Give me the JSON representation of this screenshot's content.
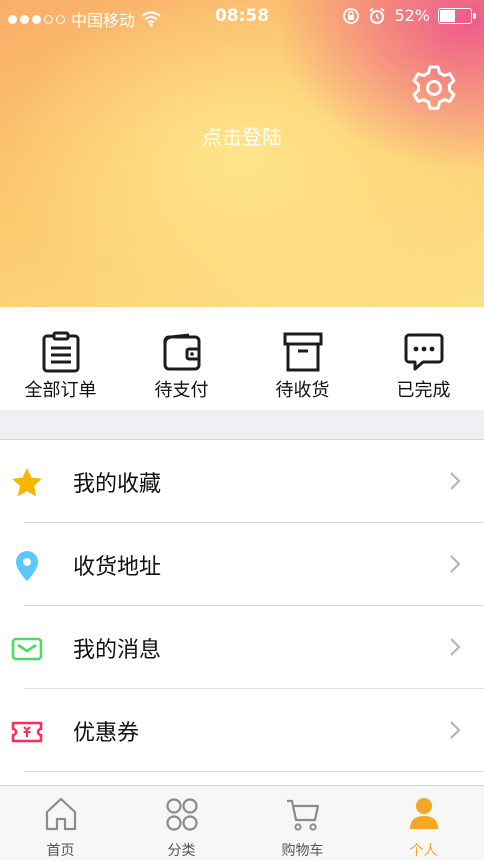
{
  "status_bar": {
    "carrier": "中国移动",
    "time": "08:58",
    "battery_percent": "52%",
    "battery_level": 0.52
  },
  "header": {
    "login_text": "点击登陆",
    "settings_icon": "gear-icon"
  },
  "orders": [
    {
      "label": "全部订单",
      "icon": "clipboard-icon"
    },
    {
      "label": "待支付",
      "icon": "wallet-icon"
    },
    {
      "label": "待收货",
      "icon": "box-icon"
    },
    {
      "label": "已完成",
      "icon": "chat-bubble-icon"
    }
  ],
  "menu": [
    {
      "label": "我的收藏",
      "icon": "star-icon",
      "color": "#f7b500"
    },
    {
      "label": "收货地址",
      "icon": "location-pin-icon",
      "color": "#5ac8fa"
    },
    {
      "label": "我的消息",
      "icon": "envelope-icon",
      "color": "#4cd964"
    },
    {
      "label": "优惠券",
      "icon": "ticket-icon",
      "color": "#ff2d55"
    }
  ],
  "tabbar": {
    "items": [
      {
        "label": "首页",
        "icon": "home-icon"
      },
      {
        "label": "分类",
        "icon": "grid-icon"
      },
      {
        "label": "购物车",
        "icon": "cart-icon"
      },
      {
        "label": "个人",
        "icon": "person-icon"
      }
    ],
    "active_color": "#f5a623",
    "inactive_color": "#8a8a8f"
  }
}
